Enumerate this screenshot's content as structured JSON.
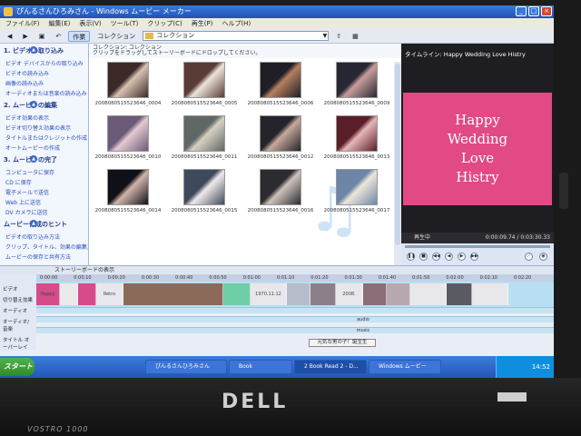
{
  "window": {
    "title": "ぴんるさんひろみさん - Windows ムービー メーカー",
    "controls": [
      "_",
      "□",
      "×"
    ]
  },
  "menu": [
    "ファイル(F)",
    "編集(E)",
    "表示(V)",
    "ツール(T)",
    "クリップ(C)",
    "再生(P)",
    "ヘルプ(H)"
  ],
  "toolbar": {
    "tasks_label": "作業",
    "collection_label": "コレクション",
    "collection_value": "コレクション"
  },
  "tasks_pane": {
    "sections": [
      {
        "title": "1. ビデオの取り込み",
        "items": [
          "ビデオ デバイスからの取り込み",
          "ビデオの読み込み",
          "画像の読み込み",
          "オーディオまたは音楽の読み込み"
        ]
      },
      {
        "title": "2. ムービーの編集",
        "items": [
          "ビデオ効果の表示",
          "ビデオ切り替え効果の表示",
          "タイトルまたはクレジットの作成",
          "オートムービーの作成"
        ]
      },
      {
        "title": "3. ムービーの完了",
        "items": [
          "コンピュータに保存",
          "CD に保存",
          "電子メールで送信",
          "Web 上に送信",
          "DV カメラに送信"
        ]
      },
      {
        "title": "ムービー作成のヒント",
        "items": [
          "ビデオの取り込み方法",
          "クリップ、タイトル、効果の編集方法",
          "ムービーの保存と共有方法"
        ]
      }
    ]
  },
  "collection_pane": {
    "header": "コレクション: コレクション",
    "hint": "クリップをドラッグしてストーリーボードにドロップしてください。",
    "clips": [
      {
        "label": "2008080515523646_0004",
        "c1": "#3b2a28",
        "c2": "#d9c2b0"
      },
      {
        "label": "2008080515523646_0005",
        "c1": "#5a3c34",
        "c2": "#ece4dc"
      },
      {
        "label": "2008080515523646_0006",
        "c1": "#1e1e24",
        "c2": "#b57f60"
      },
      {
        "label": "2008080515523646_0009",
        "c1": "#272733",
        "c2": "#c79d9a"
      },
      {
        "label": "2008080515523646_0010",
        "c1": "#6b5a78",
        "c2": "#e3c9cf"
      },
      {
        "label": "2008080515523646_0011",
        "c1": "#5f6866",
        "c2": "#d7d0c2"
      },
      {
        "label": "2008080515523646_0012",
        "c1": "#24242b",
        "c2": "#c6a899"
      },
      {
        "label": "2008080515523646_0013",
        "c1": "#5a1e28",
        "c2": "#e5b6b8"
      },
      {
        "label": "2008080515523646_0014",
        "c1": "#101018",
        "c2": "#d1b4a9"
      },
      {
        "label": "2008080515523646_0015",
        "c1": "#3e4a5c",
        "c2": "#f0eaea"
      },
      {
        "label": "2008080515523646_0016",
        "c1": "#2b2b30",
        "c2": "#cfc3bb"
      },
      {
        "label": "2008080515523646_0017",
        "c1": "#6d86a8",
        "c2": "#eee6d8"
      }
    ]
  },
  "preview": {
    "title": "タイムライン: Happy Wedding Love Histry",
    "screen_lines": [
      "Happy",
      "Wedding",
      "Love",
      "Histry"
    ],
    "status": "再生中",
    "time": "0:00:09.74 / 0:03:30.33"
  },
  "timeline": {
    "toggle_label": "ストーリーボードの表示",
    "ruler": [
      "0:00:00",
      "0:00:10",
      "0:00:20",
      "0:00:30",
      "0:00:40",
      "0:00:50",
      "0:01:00",
      "0:01:10",
      "0:01:20",
      "0:01:30",
      "0:01:40",
      "0:01:50",
      "0:02:00",
      "0:02:10",
      "0:02:20"
    ],
    "tracks": [
      "ビデオ",
      "切り替え効果",
      "オーディオ",
      "オーディオ/音楽",
      "タイトル オーバーレイ"
    ],
    "video_clips": [
      {
        "label": "Happy",
        "color": "#d64c8a",
        "w": 26
      },
      {
        "label": "",
        "color": "#eaeaea",
        "w": 20
      },
      {
        "label": "",
        "color": "#d64c8a",
        "w": 20
      },
      {
        "label": "Retro",
        "color": "#e8e8ec",
        "w": 30
      },
      {
        "label": "",
        "color": "#8c6a5a",
        "w": 110
      },
      {
        "label": "",
        "color": "#6fcfa6",
        "w": 30
      },
      {
        "label": "1970.11.12",
        "color": "#e8e8ec",
        "w": 40
      },
      {
        "label": "",
        "color": "#b6bccb",
        "w": 26
      },
      {
        "label": "",
        "color": "#8d7f8a",
        "w": 28
      },
      {
        "label": "2008.",
        "color": "#e8e8ec",
        "w": 30
      },
      {
        "label": "",
        "color": "#8a6e78",
        "w": 26
      },
      {
        "label": "",
        "color": "#b8a8b0",
        "w": 26
      },
      {
        "label": "",
        "color": "#e8e8ec",
        "w": 40
      },
      {
        "label": "",
        "color": "#5a5a62",
        "w": 28
      },
      {
        "label": "",
        "color": "#e8e8ec",
        "w": 40
      }
    ],
    "audio_label": "audio",
    "music_label": "music",
    "title_overlay": "元気な男の子！誕生生"
  },
  "taskbar": {
    "start": "スタート",
    "buttons": [
      "ぴんるさんひろみさん",
      "Book",
      "2 Book Read 2 - D...",
      "Windows ムービー"
    ],
    "tray_time": "14:52"
  },
  "hardware": {
    "brand": "DELL",
    "model": "VOSTRO 1000"
  }
}
